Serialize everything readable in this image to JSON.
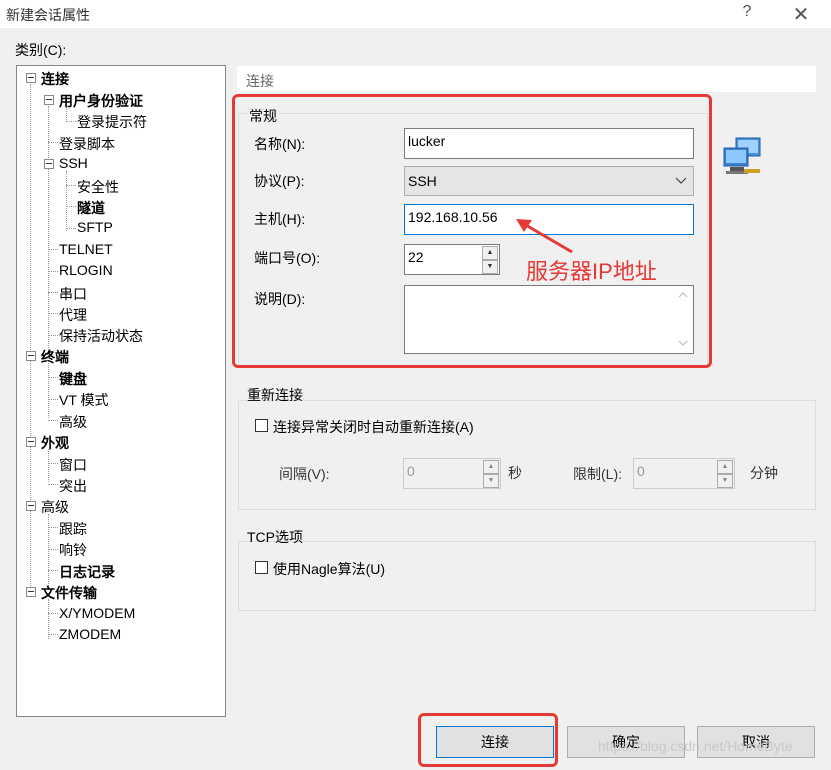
{
  "window": {
    "title": "新建会话属性",
    "help": "?",
    "close": "✕"
  },
  "category_label": "类别(C):",
  "tree": [
    {
      "label": "连接",
      "bold": true
    },
    {
      "label": "用户身份验证",
      "bold": true
    },
    {
      "label": "登录提示符",
      "bold": false
    },
    {
      "label": "登录脚本",
      "bold": false
    },
    {
      "label": "SSH",
      "bold": false
    },
    {
      "label": "安全性",
      "bold": false
    },
    {
      "label": "隧道",
      "bold": true
    },
    {
      "label": "SFTP",
      "bold": false
    },
    {
      "label": "TELNET",
      "bold": false
    },
    {
      "label": "RLOGIN",
      "bold": false
    },
    {
      "label": "串口",
      "bold": false
    },
    {
      "label": "代理",
      "bold": false
    },
    {
      "label": "保持活动状态",
      "bold": false
    },
    {
      "label": "终端",
      "bold": true
    },
    {
      "label": "键盘",
      "bold": true
    },
    {
      "label": "VT 模式",
      "bold": false
    },
    {
      "label": "高级",
      "bold": false
    },
    {
      "label": "外观",
      "bold": true
    },
    {
      "label": "窗口",
      "bold": false
    },
    {
      "label": "突出",
      "bold": false
    },
    {
      "label": "高级",
      "bold": false
    },
    {
      "label": "跟踪",
      "bold": false
    },
    {
      "label": "响铃",
      "bold": false
    },
    {
      "label": "日志记录",
      "bold": true
    },
    {
      "label": "文件传输",
      "bold": true
    },
    {
      "label": "X/YMODEM",
      "bold": false
    },
    {
      "label": "ZMODEM",
      "bold": false
    }
  ],
  "panel_header": "连接",
  "general": {
    "title": "常规",
    "name_label": "名称(N):",
    "name_value": "lucker",
    "protocol_label": "协议(P):",
    "protocol_value": "SSH",
    "host_label": "主机(H):",
    "host_value": "192.168.10.56",
    "port_label": "端口号(O):",
    "port_value": "22",
    "desc_label": "说明(D):",
    "desc_value": ""
  },
  "reconnect": {
    "title": "重新连接",
    "checkbox_label": "连接异常关闭时自动重新连接(A)",
    "interval_label": "间隔(V):",
    "interval_value": "0",
    "interval_unit": "秒",
    "limit_label": "限制(L):",
    "limit_value": "0",
    "limit_unit": "分钟"
  },
  "tcp": {
    "title": "TCP选项",
    "nagle_label": "使用Nagle算法(U)"
  },
  "buttons": {
    "connect": "连接",
    "ok": "确定",
    "cancel": "取消"
  },
  "annotation": "服务器IP地址",
  "watermark": "https://blog.csdn.net/HomeByte",
  "colors": {
    "annotation": "#e53935",
    "focus": "#0078d7"
  }
}
